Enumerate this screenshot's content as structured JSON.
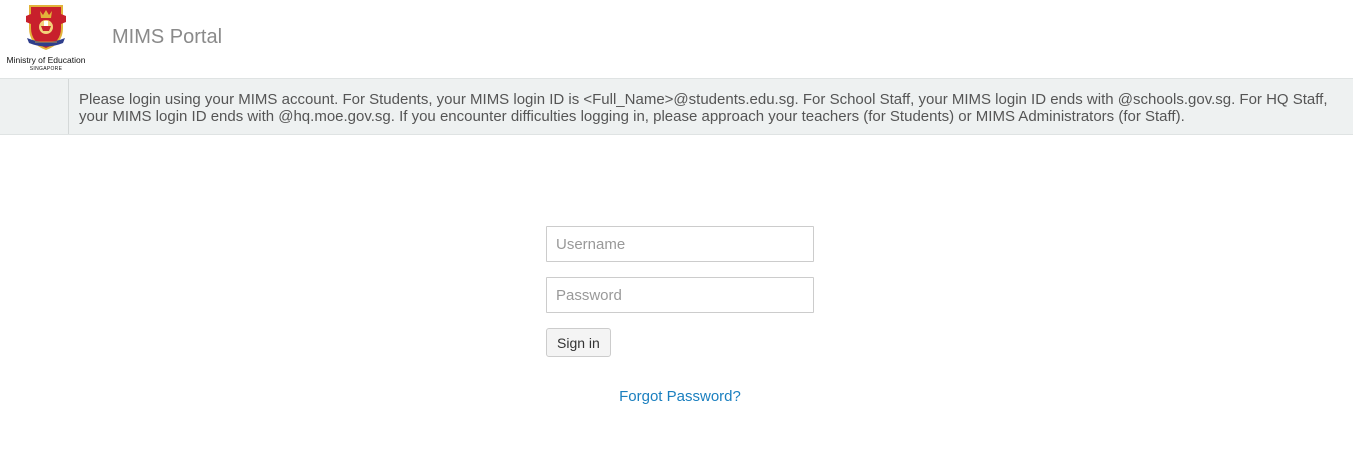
{
  "header": {
    "logo": {
      "icon": "crest-icon",
      "name": "Ministry of Education",
      "sub": "SINGAPORE",
      "colors": {
        "shield": "#c8202c",
        "gold": "#e2b33a",
        "ribbon": "#2f3e8c"
      }
    },
    "title": "MIMS Portal"
  },
  "notice": {
    "text": "Please login using your MIMS account. For Students, your MIMS login ID is <Full_Name>@students.edu.sg. For School Staff, your MIMS login ID ends with @schools.gov.sg. For HQ Staff, your MIMS login ID ends with @hq.moe.gov.sg. If you encounter difficulties logging in, please approach your teachers (for Students) or MIMS Administrators (for Staff)."
  },
  "login": {
    "username": {
      "value": "",
      "placeholder": "Username"
    },
    "password": {
      "value": "",
      "placeholder": "Password"
    },
    "signin_label": "Sign in",
    "forgot_label": "Forgot Password?"
  },
  "colors": {
    "link": "#1a7fbf",
    "notice_bg": "#eef1f1",
    "title": "#8a8a8a"
  }
}
